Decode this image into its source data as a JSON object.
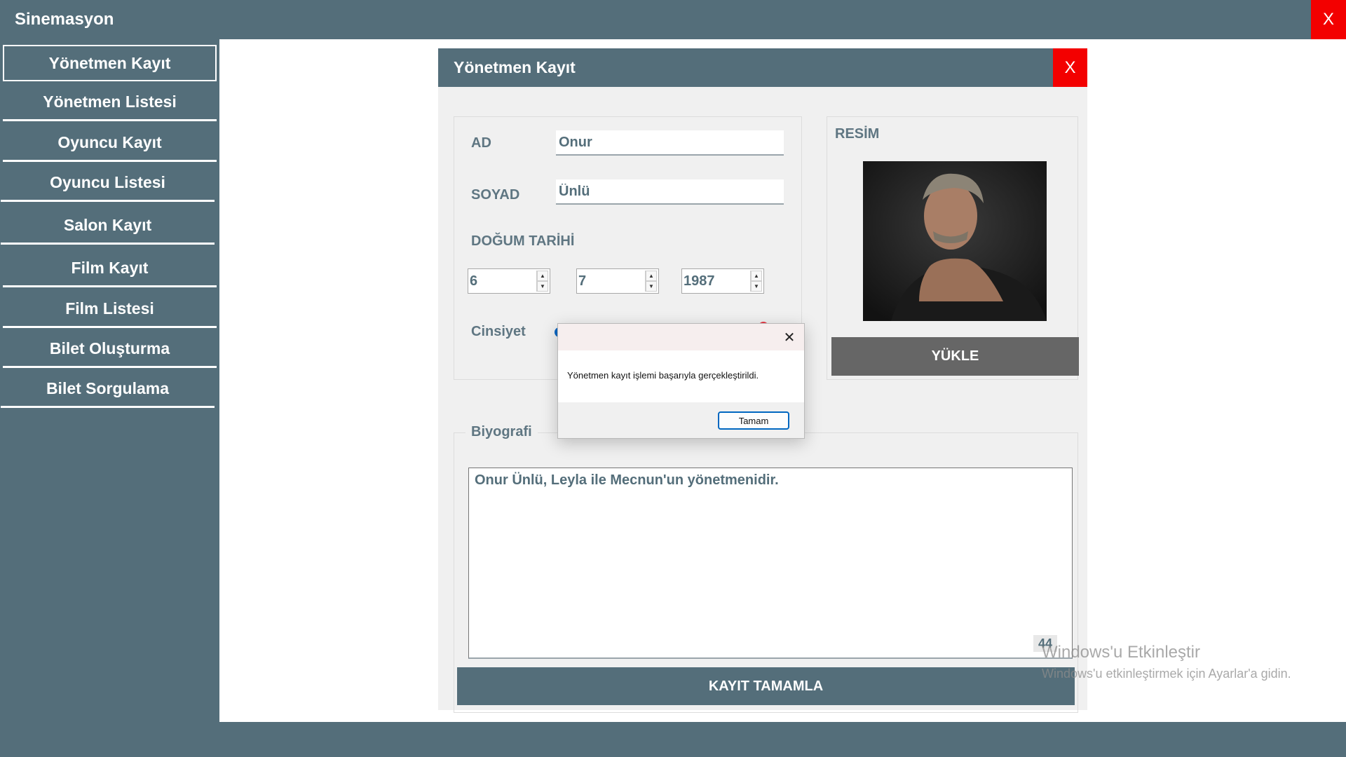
{
  "app": {
    "title": "Sinemasyon",
    "close_label": "X"
  },
  "sidebar": {
    "items": [
      {
        "label": "Yönetmen Kayıt"
      },
      {
        "label": "Yönetmen Listesi"
      },
      {
        "label": "Oyuncu Kayıt"
      },
      {
        "label": "Oyuncu Listesi"
      },
      {
        "label": "Salon Kayıt"
      },
      {
        "label": "Film Kayıt"
      },
      {
        "label": "Film Listesi"
      },
      {
        "label": "Bilet Oluşturma"
      },
      {
        "label": "Bilet Sorgulama"
      }
    ]
  },
  "form": {
    "title": "Yönetmen Kayıt",
    "close_label": "X",
    "ad_label": "AD",
    "ad_value": "Onur",
    "soyad_label": "SOYAD",
    "soyad_value": "Ünlü",
    "birth_label": "DOĞUM TARİHİ",
    "birth_day": "6",
    "birth_month": "7",
    "birth_year": "1987",
    "gender_label": "Cinsiyet",
    "image_label": "RESİM",
    "upload_label": "YÜKLE",
    "bio_label": "Biyografi",
    "bio_value": "Onur Ünlü, Leyla ile Mecnun'un yönetmenidir.",
    "char_count": "44",
    "submit_label": "KAYIT TAMAMLA"
  },
  "dialog": {
    "close_label": "✕",
    "message": "Yönetmen kayıt işlemi başarıyla gerçekleştirildi.",
    "ok_label": "Tamam"
  },
  "watermark": {
    "line1": "Windows'u Etkinleştir",
    "line2": "Windows'u etkinleştirmek için Ayarlar'a gidin."
  },
  "colors": {
    "brand": "#546e7a",
    "close": "#f30000",
    "radio_blue": "#0a66c2",
    "radio_red": "#e63946"
  },
  "icons": [
    "close-icon",
    "spin-up-icon",
    "spin-down-icon"
  ]
}
